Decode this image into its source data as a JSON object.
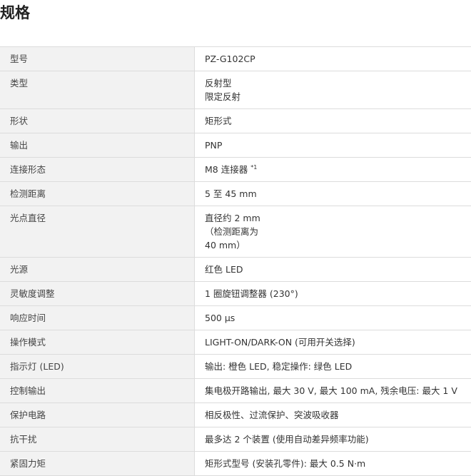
{
  "page": {
    "title": "规格"
  },
  "specs": [
    {
      "label": "型号",
      "lines": [
        "PZ-G102CP"
      ]
    },
    {
      "label": "类型",
      "lines": [
        "反射型",
        "限定反射"
      ]
    },
    {
      "label": "形状",
      "lines": [
        "矩形式"
      ]
    },
    {
      "label": "输出",
      "lines": [
        "PNP"
      ]
    },
    {
      "label": "连接形态",
      "lines": [
        "M8 连接器 "
      ],
      "note": "*1"
    },
    {
      "label": "检测距离",
      "lines": [
        "5 至 45 mm"
      ]
    },
    {
      "label": "光点直径",
      "lines": [
        "直径约 2 mm",
        "（检测距离为",
        "40 mm）"
      ]
    },
    {
      "label": "光源",
      "lines": [
        "红色 LED"
      ]
    },
    {
      "label": "灵敏度调整",
      "lines": [
        "1 圈旋钮调整器 (230°)"
      ]
    },
    {
      "label": "响应时间",
      "lines": [
        "500 μs"
      ]
    },
    {
      "label": "操作模式",
      "lines": [
        "LIGHT-ON/DARK-ON (可用开关选择)"
      ]
    },
    {
      "label": "指示灯 (LED)",
      "lines": [
        "输出: 橙色 LED, 稳定操作: 绿色 LED"
      ]
    },
    {
      "label": "控制输出",
      "lines": [
        "集电极开路输出, 最大 30 V, 最大 100 mA, 残余电压: 最大 1 V"
      ]
    },
    {
      "label": "保护电路",
      "lines": [
        "相反极性、过流保护、突波吸收器"
      ]
    },
    {
      "label": "抗干扰",
      "lines": [
        "最多达 2 个装置 (使用自动差异频率功能)"
      ]
    },
    {
      "label": "紧固力矩",
      "lines": [
        "矩形式型号 (安装孔零件): 最大 0.5 N·m"
      ]
    }
  ]
}
